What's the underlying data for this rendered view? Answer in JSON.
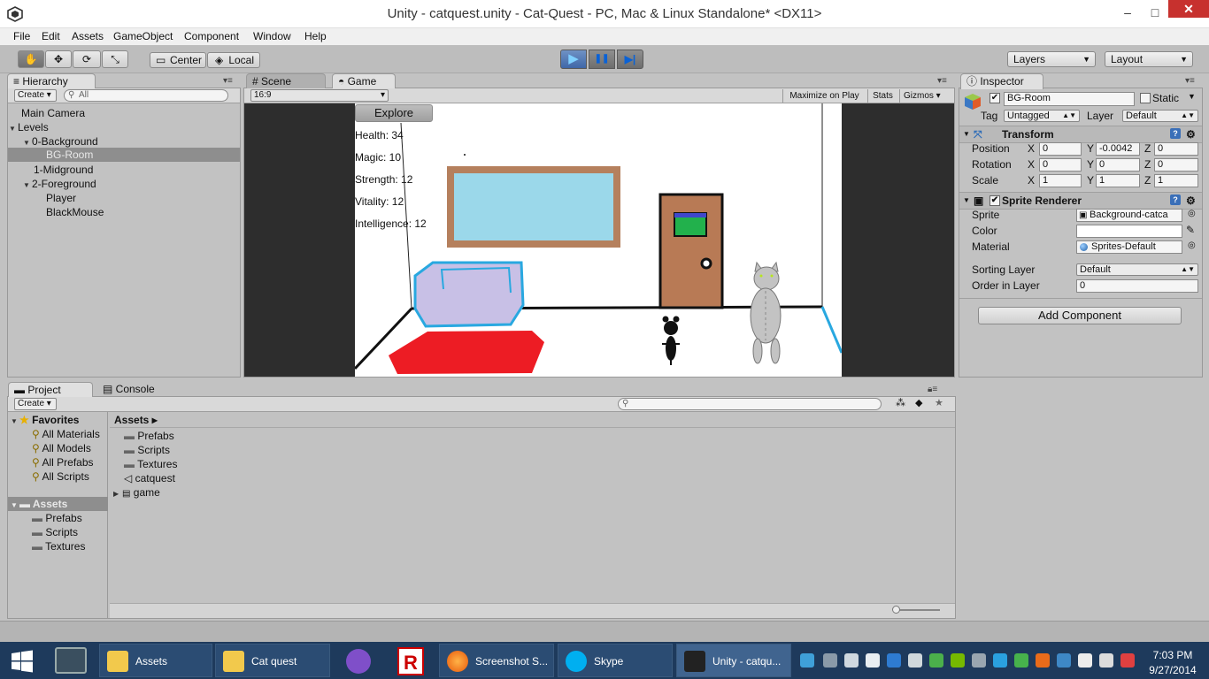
{
  "window": {
    "title": "Unity - catquest.unity - Cat-Quest - PC, Mac & Linux Standalone* <DX11>",
    "minimize": "‒",
    "maximize": "□",
    "close": "✕"
  },
  "menu": [
    "File",
    "Edit",
    "Assets",
    "GameObject",
    "Component",
    "Window",
    "Help"
  ],
  "toolbar": {
    "center": "Center",
    "local": "Local",
    "layers": "Layers",
    "layout": "Layout",
    "play": "▶",
    "pause": "❚❚",
    "step": "▶|"
  },
  "hierarchy": {
    "tab": "Hierarchy",
    "create": "Create",
    "search_placeholder": "All",
    "items": [
      {
        "label": "Main Camera"
      },
      {
        "label": "Levels"
      },
      {
        "label": "0-Background"
      },
      {
        "label": "BG-Room"
      },
      {
        "label": "1-Midground"
      },
      {
        "label": "2-Foreground"
      },
      {
        "label": "Player"
      },
      {
        "label": "BlackMouse"
      }
    ]
  },
  "scene_tabs": {
    "scene": "Scene",
    "game": "Game"
  },
  "game_bar": {
    "aspect": "16:9",
    "maximize": "Maximize on Play",
    "stats": "Stats",
    "gizmos": "Gizmos"
  },
  "game": {
    "explore": "Explore",
    "stats": [
      "Health: 34",
      "Magic: 10",
      "Strength: 12",
      "Vitality: 12",
      "Intelligence: 12"
    ],
    "colors": {
      "window_glass": "#9bd8ea",
      "window_frame": "#b5805d",
      "door": "#b87a55",
      "rug": "#ed1c24",
      "couch": "#c8c0e6",
      "couch_outline": "#29a8e0"
    }
  },
  "inspector": {
    "tab": "Inspector",
    "object_name": "BG-Room",
    "static_label": "Static",
    "tag_label": "Tag",
    "tag_value": "Untagged",
    "layer_label": "Layer",
    "layer_value": "Default",
    "transform": {
      "title": "Transform",
      "position_label": "Position",
      "rotation_label": "Rotation",
      "scale_label": "Scale",
      "x": "X",
      "y": "Y",
      "z": "Z",
      "position": [
        "0",
        "-0.0042",
        "0"
      ],
      "rotation": [
        "0",
        "0",
        "0"
      ],
      "scale": [
        "1",
        "1",
        "1"
      ]
    },
    "sprite_renderer": {
      "title": "Sprite Renderer",
      "sprite_label": "Sprite",
      "sprite_value": "Background-catca",
      "color_label": "Color",
      "material_label": "Material",
      "material_value": "Sprites-Default",
      "sorting_layer_label": "Sorting Layer",
      "sorting_layer_value": "Default",
      "order_label": "Order in Layer",
      "order_value": "0"
    },
    "add_component": "Add Component"
  },
  "project": {
    "tab_project": "Project",
    "tab_console": "Console",
    "create": "Create",
    "favorites_label": "Favorites",
    "favorites": [
      "All Materials",
      "All Models",
      "All Prefabs",
      "All Scripts"
    ],
    "assets_label": "Assets",
    "assets_tree": [
      "Prefabs",
      "Scripts",
      "Textures"
    ],
    "breadcrumb": "Assets ▸",
    "assets_list": [
      "Prefabs",
      "Scripts",
      "Textures",
      "catquest",
      "game"
    ]
  },
  "taskbar": {
    "tasks": [
      "Assets",
      "Cat quest",
      "Screenshot S...",
      "Skype",
      "Unity - catqu..."
    ],
    "time": "7:03 PM",
    "date": "9/27/2014"
  }
}
